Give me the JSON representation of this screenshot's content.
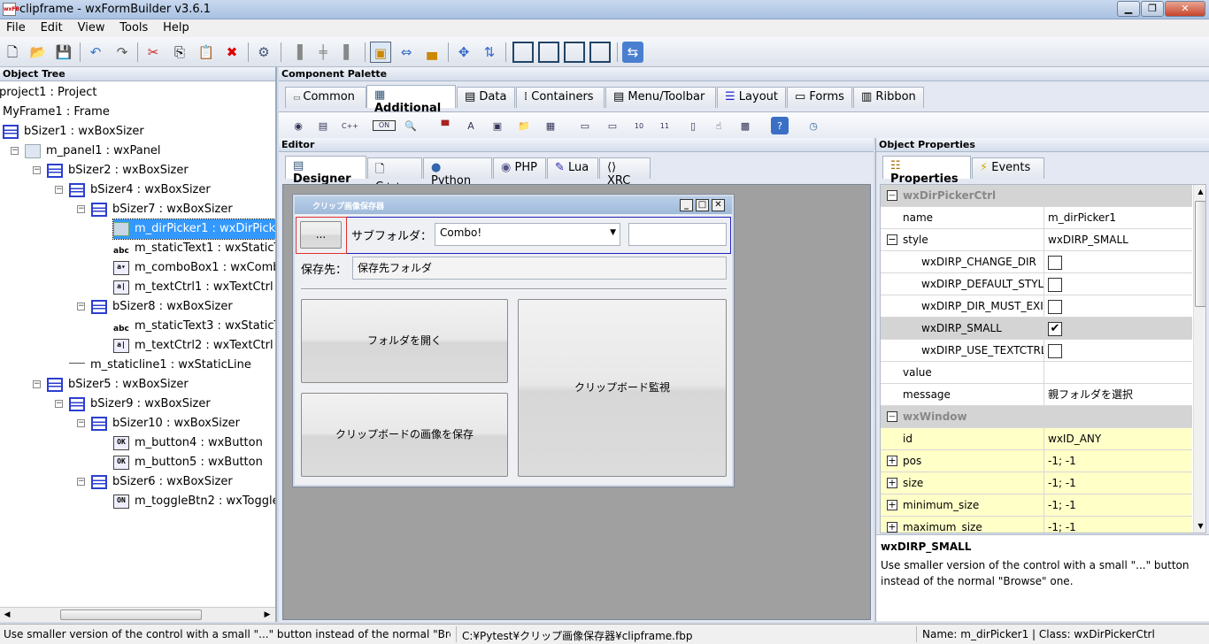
{
  "window": {
    "title": "clipframe - wxFormBuilder v3.6.1",
    "app_icon_text": "wxFB"
  },
  "menu": [
    "File",
    "Edit",
    "View",
    "Tools",
    "Help"
  ],
  "panels": {
    "object_tree": "Object Tree",
    "component_palette": "Component Palette",
    "editor": "Editor",
    "object_properties": "Object Properties"
  },
  "tree": [
    {
      "label": "project1 : Project",
      "icon": "none"
    },
    {
      "label": "MyFrame1 : Frame",
      "icon": "none"
    },
    {
      "label": "bSizer1 : wxBoxSizer",
      "icon": "sizer"
    },
    {
      "label": "m_panel1 : wxPanel",
      "icon": "panel"
    },
    {
      "label": "bSizer2 : wxBoxSizer",
      "icon": "sizer"
    },
    {
      "label": "bSizer4 : wxBoxSizer",
      "icon": "sizer"
    },
    {
      "label": "bSizer7 : wxBoxSizer",
      "icon": "sizer"
    },
    {
      "label": "m_dirPicker1 : wxDirPickerCtrl",
      "icon": "dir",
      "selected": true
    },
    {
      "label": "m_staticText1 : wxStaticText",
      "icon": "abc"
    },
    {
      "label": "m_comboBox1 : wxComboBox",
      "icon": "combo"
    },
    {
      "label": "m_textCtrl1 : wxTextCtrl",
      "icon": "text"
    },
    {
      "label": "bSizer8 : wxBoxSizer",
      "icon": "sizer"
    },
    {
      "label": "m_staticText3 : wxStaticText",
      "icon": "abc"
    },
    {
      "label": "m_textCtrl2 : wxTextCtrl",
      "icon": "text"
    },
    {
      "label": "m_staticline1 : wxStaticLine",
      "icon": "line"
    },
    {
      "label": "bSizer5 : wxBoxSizer",
      "icon": "sizer"
    },
    {
      "label": "bSizer9 : wxBoxSizer",
      "icon": "sizer"
    },
    {
      "label": "bSizer10 : wxBoxSizer",
      "icon": "sizer"
    },
    {
      "label": "m_button4 : wxButton",
      "icon": "ok"
    },
    {
      "label": "m_button5 : wxButton",
      "icon": "ok"
    },
    {
      "label": "bSizer6 : wxBoxSizer",
      "icon": "sizer"
    },
    {
      "label": "m_toggleBtn2 : wxToggleButton",
      "icon": "on"
    }
  ],
  "palette_tabs": [
    "Common",
    "Additional",
    "Data",
    "Containers",
    "Menu/Toolbar",
    "Layout",
    "Forms",
    "Ribbon"
  ],
  "palette_active": "Additional",
  "palette_icon_labels": {
    "on": "ON",
    "cpp": "C++",
    "ten": "10",
    "eleven": "11"
  },
  "editor_tabs": [
    "Designer",
    "C++",
    "Python",
    "PHP",
    "Lua",
    "XRC"
  ],
  "designer": {
    "frame_title": "クリップ画像保存器",
    "dir_button": "...",
    "subfolder_label": "サブフォルダ：",
    "combo_value": "Combo!",
    "save_to_label": "保存先：",
    "save_to_value": "保存先フォルダ",
    "open_folder_button": "フォルダを開く",
    "save_image_button": "クリップボードの画像を保存",
    "watch_toggle": "クリップボード監視"
  },
  "props_tabs": [
    "Properties",
    "Events"
  ],
  "properties": [
    {
      "kind": "cat",
      "name": "wxDirPickerCtrl"
    },
    {
      "kind": "row",
      "name": "name",
      "value": "m_dirPicker1"
    },
    {
      "kind": "row",
      "name": "style",
      "value": "wxDIRP_SMALL",
      "toggle": "−"
    },
    {
      "kind": "sub",
      "name": "wxDIRP_CHANGE_DIR",
      "check": ""
    },
    {
      "kind": "sub",
      "name": "wxDIRP_DEFAULT_STYLE",
      "check": ""
    },
    {
      "kind": "sub",
      "name": "wxDIRP_DIR_MUST_EXIST",
      "check": ""
    },
    {
      "kind": "subsel",
      "name": "wxDIRP_SMALL",
      "check": "✔"
    },
    {
      "kind": "sub",
      "name": "wxDIRP_USE_TEXTCTRL",
      "check": ""
    },
    {
      "kind": "row",
      "name": "value",
      "value": ""
    },
    {
      "kind": "row",
      "name": "message",
      "value": "親フォルダを選択"
    },
    {
      "kind": "cat",
      "name": "wxWindow"
    },
    {
      "kind": "yellow",
      "name": "id",
      "value": "wxID_ANY"
    },
    {
      "kind": "yellow",
      "name": "pos",
      "value": "-1; -1",
      "toggle": "+"
    },
    {
      "kind": "yellow",
      "name": "size",
      "value": "-1; -1",
      "toggle": "+"
    },
    {
      "kind": "yellow",
      "name": "minimum_size",
      "value": "-1; -1",
      "toggle": "+"
    },
    {
      "kind": "yellow",
      "name": "maximum_size",
      "value": "-1; -1",
      "toggle": "+"
    }
  ],
  "description": {
    "title": "wxDIRP_SMALL",
    "text": "Use smaller version of the control with a small \"...\" button instead of the normal \"Browse\" one."
  },
  "status": {
    "left": "Use smaller version of the control with a small \"...\" button instead of the normal \"Bro...",
    "file": "C:¥Pytest¥クリップ画像保存器¥clipframe.fbp",
    "right": "Name: m_dirPicker1 | Class: wxDirPickerCtrl"
  },
  "colors": {
    "selection": "#3399ff",
    "highlight_border": "#e03030",
    "sizer_border": "#2020c0"
  }
}
